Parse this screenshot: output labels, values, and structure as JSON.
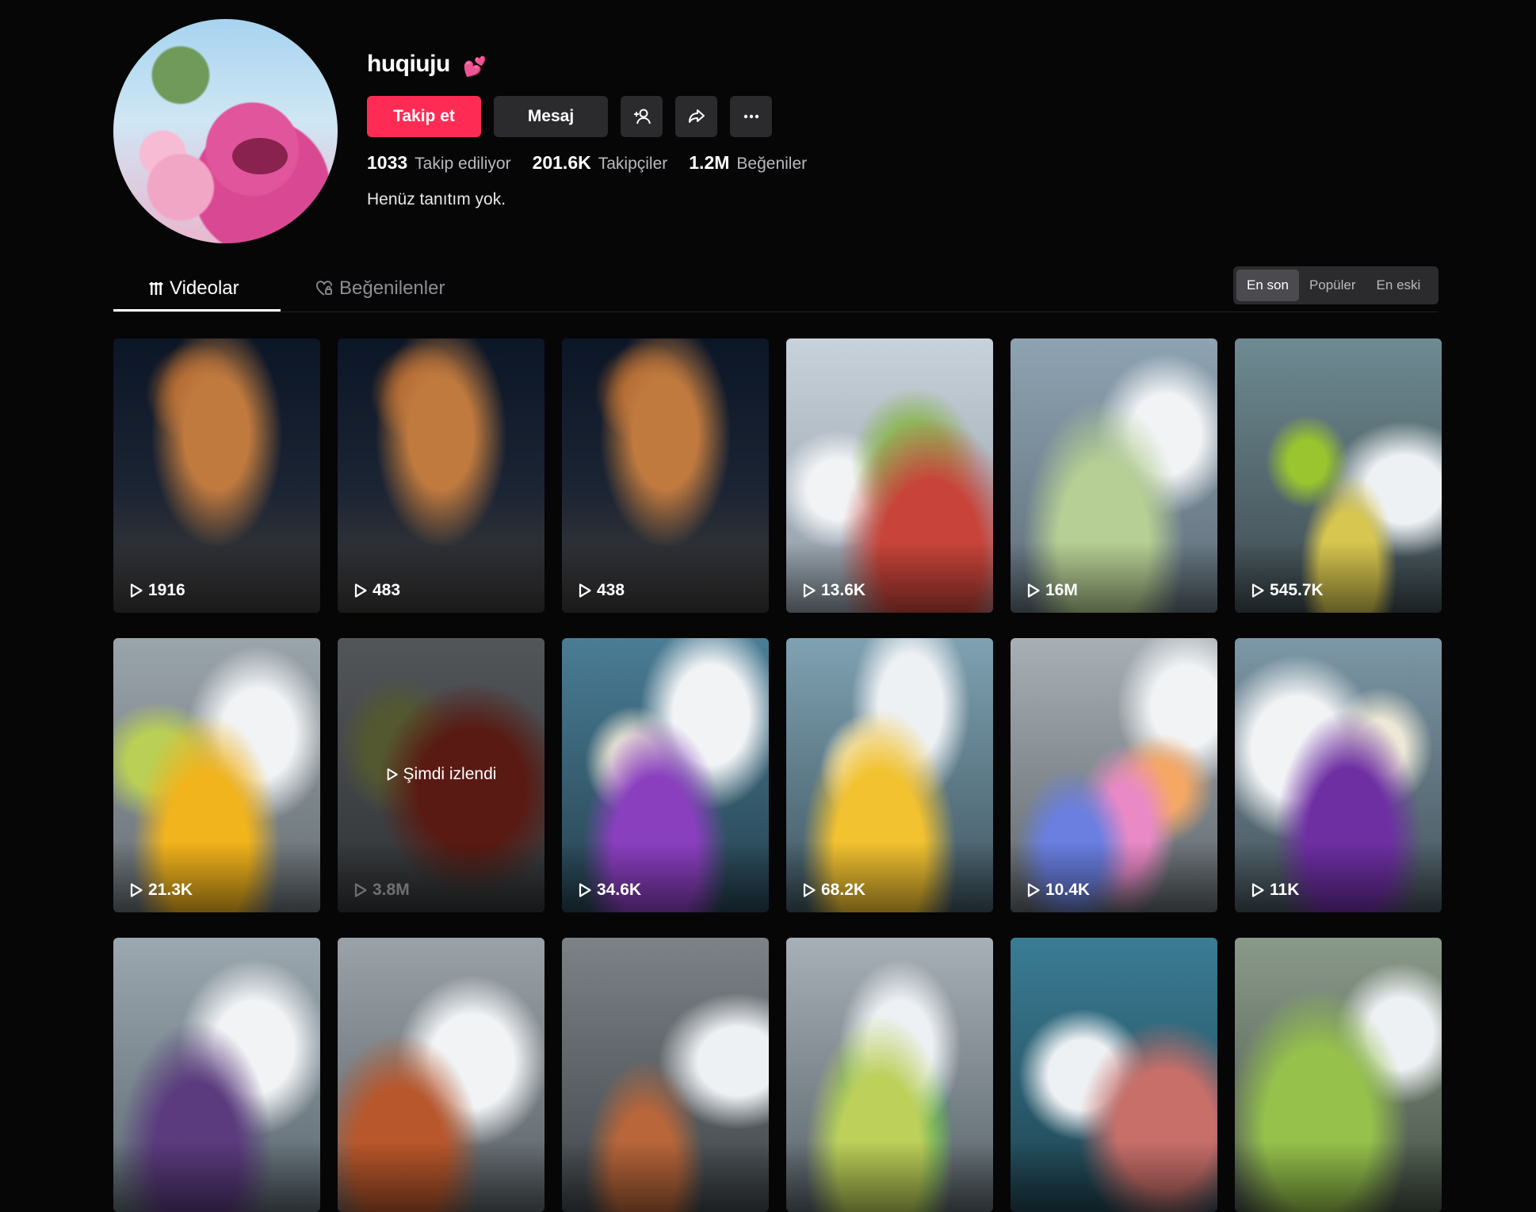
{
  "profile": {
    "username": "huqiuju",
    "follow_label": "Takip et",
    "message_label": "Mesaj",
    "stats": [
      {
        "value": "1033",
        "label": "Takip ediliyor"
      },
      {
        "value": "201.6K",
        "label": "Takipçiler"
      },
      {
        "value": "1.2M",
        "label": "Beğeniler"
      }
    ],
    "bio": "Henüz tanıtım yok."
  },
  "tabs": {
    "videos": "Videolar",
    "liked": "Beğenilenler"
  },
  "sort": {
    "latest": "En son",
    "popular": "Popüler",
    "oldest": "En eski"
  },
  "videos": [
    {
      "views": "1916",
      "theme": "chickens-tree"
    },
    {
      "views": "483",
      "theme": "chickens-tree"
    },
    {
      "views": "438",
      "theme": "chickens-tree"
    },
    {
      "views": "13.6K",
      "theme": "factory-apples"
    },
    {
      "views": "16M",
      "theme": "factory-zucchini"
    },
    {
      "views": "545.7K",
      "theme": "factory-bananas"
    },
    {
      "views": "21.3K",
      "theme": "factory-lemons"
    },
    {
      "views": "3.8M",
      "theme": "factory-red-apples",
      "watched_label": "Şimdi izlendi"
    },
    {
      "views": "34.6K",
      "theme": "factory-cauliflower"
    },
    {
      "views": "68.2K",
      "theme": "factory-corn"
    },
    {
      "views": "10.4K",
      "theme": "factory-flowers"
    },
    {
      "views": "11K",
      "theme": "factory-purple-corn"
    },
    {
      "views": "",
      "theme": "factory-broccoli"
    },
    {
      "views": "",
      "theme": "factory-crabs"
    },
    {
      "views": "",
      "theme": "factory-spray"
    },
    {
      "views": "",
      "theme": "factory-green-apples"
    },
    {
      "views": "",
      "theme": "factory-meat"
    },
    {
      "views": "",
      "theme": "factory-limes"
    }
  ],
  "colors": {
    "accent": "#fe2c55",
    "background": "#060607",
    "button_bg": "#2b2b2e"
  }
}
